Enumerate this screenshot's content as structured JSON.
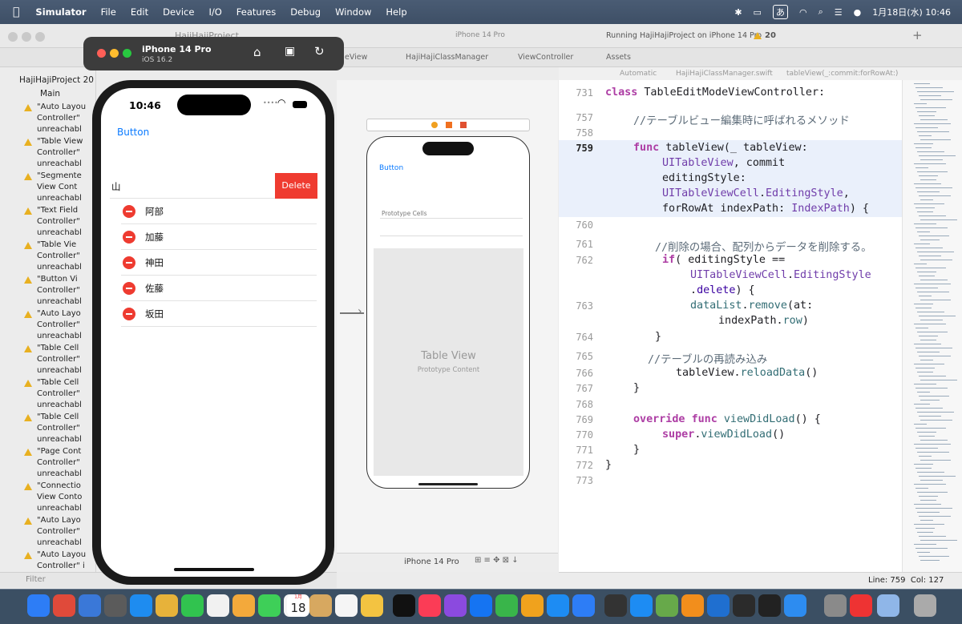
{
  "menubar": {
    "app": "Simulator",
    "items": [
      "File",
      "Edit",
      "Device",
      "I/O",
      "Features",
      "Debug",
      "Window",
      "Help"
    ],
    "clock": "1月18日(水) 10:46",
    "ime": "あ"
  },
  "xcode": {
    "scheme": "HajiHajiProject",
    "device": "iPhone 14 Pro",
    "status": "Running HajiHajiProject on iPhone 14 Pro",
    "warnings_count": "20",
    "tabs": [
      "eView",
      "HajiHajiClassManager",
      "ViewController",
      "Assets"
    ],
    "jump": [
      "Automatic",
      "HajiHajiClassManager.swift",
      "tableView(_:commit:forRowAt:)"
    ],
    "ib_jump": [
      "T...e",
      "T...er",
      "View",
      "Editable Table View"
    ]
  },
  "navigator": {
    "project": "HajiHajiProject 20 issu",
    "group": "Main",
    "issues": [
      [
        "\"Auto Layou",
        "Controller\"",
        "unreachabl"
      ],
      [
        "\"Table View",
        "Controller\"",
        "unreachabl"
      ],
      [
        "\"Segmente",
        "View Cont",
        "unreachabl"
      ],
      [
        "\"Text Field",
        "Controller\"",
        "unreachabl"
      ],
      [
        "\"Table Vie",
        "Controller\"",
        "unreachabl"
      ],
      [
        "\"Button Vi",
        "Controller\"",
        "unreachabl"
      ],
      [
        "\"Auto Layo",
        "Controller\"",
        "unreachabl"
      ],
      [
        "\"Table Cell",
        "Controller\"",
        "unreachabl"
      ],
      [
        "\"Table Cell",
        "Controller\"",
        "unreachabl"
      ],
      [
        "\"Table Cell",
        "Controller\"",
        "unreachabl"
      ],
      [
        "\"Page Cont",
        "Controller\"",
        "unreachabl"
      ],
      [
        "\"Connectio",
        "View Conto",
        "unreachabl"
      ],
      [
        "\"Auto Layo",
        "Controller\"",
        "unreachabl"
      ],
      [
        "\"Auto Layou",
        "Controller\" i",
        ""
      ]
    ],
    "filter": "Filter"
  },
  "ib": {
    "button": "Button",
    "prototype_cells": "Prototype Cells",
    "table_title": "Table View",
    "table_sub": "Prototype Content",
    "device": "iPhone 14 Pro"
  },
  "simulator": {
    "device": "iPhone 14 Pro",
    "os": "iOS 16.2",
    "time": "10:46",
    "button": "Button",
    "swiped_row": "山",
    "delete": "Delete",
    "rows": [
      "阿部",
      "加藤",
      "神田",
      "佐藤",
      "坂田"
    ]
  },
  "editor": {
    "status": "Line: 759  Col: 127",
    "lines": [
      {
        "n": "731",
        "t": "class TableEditModeViewController:"
      },
      {
        "n": "757",
        "t": "//テーブルビュー編集時に呼ばれるメソッド"
      },
      {
        "n": "758",
        "t": ""
      },
      {
        "n": "759",
        "t": "func tableView(_ tableView:"
      },
      {
        "n": "",
        "t": "UITableView, commit"
      },
      {
        "n": "",
        "t": "editingStyle:"
      },
      {
        "n": "",
        "t": "UITableViewCell.EditingStyle,"
      },
      {
        "n": "",
        "t": "forRowAt indexPath: IndexPath) {"
      },
      {
        "n": "760",
        "t": ""
      },
      {
        "n": "761",
        "t": "//削除の場合、配列からデータを削除する。"
      },
      {
        "n": "762",
        "t": "if( editingStyle =="
      },
      {
        "n": "",
        "t": "UITableViewCell.EditingStyle"
      },
      {
        "n": "",
        "t": ".delete) {"
      },
      {
        "n": "763",
        "t": "dataList.remove(at:"
      },
      {
        "n": "",
        "t": "indexPath.row)"
      },
      {
        "n": "764",
        "t": "}"
      },
      {
        "n": "765",
        "t": "//テーブルの再読み込み"
      },
      {
        "n": "766",
        "t": "tableView.reloadData()"
      },
      {
        "n": "767",
        "t": "}"
      },
      {
        "n": "768",
        "t": ""
      },
      {
        "n": "769",
        "t": "override func viewDidLoad() {"
      },
      {
        "n": "770",
        "t": "super.viewDidLoad()"
      },
      {
        "n": "771",
        "t": "}"
      },
      {
        "n": "772",
        "t": "}"
      },
      {
        "n": "773",
        "t": ""
      }
    ]
  },
  "dock": {
    "calendar_month": "1月",
    "calendar_day": "18"
  },
  "colors": {
    "accent": "#0a7aff",
    "delete": "#ef3b30",
    "minus": "#ee3b30"
  }
}
